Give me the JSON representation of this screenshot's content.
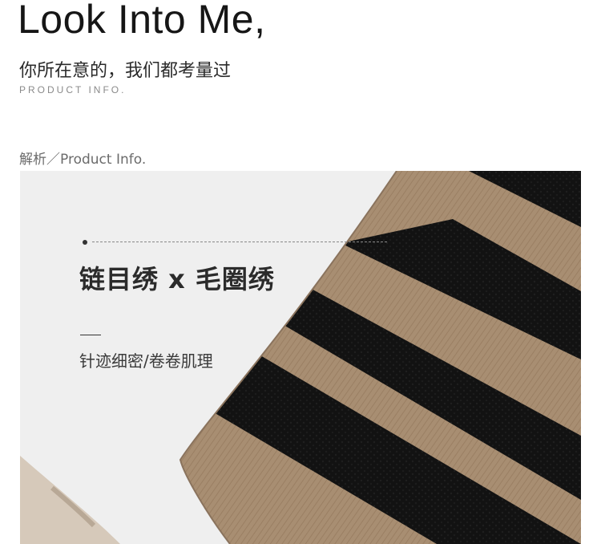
{
  "header": {
    "headline": "Look Into Me,",
    "subtitle_cn": "你所在意的，我们都考量过",
    "subtitle_en": "PRODUCT INFO."
  },
  "section": {
    "label": "解析／Product Info."
  },
  "feature": {
    "title": "链目绣 x 毛圈绣",
    "description": "针迹细密/卷卷肌理"
  },
  "colors": {
    "background": "#ffffff",
    "photo_background": "#efefef",
    "stripe_tan": "#a88e72",
    "stripe_black": "#121212"
  }
}
